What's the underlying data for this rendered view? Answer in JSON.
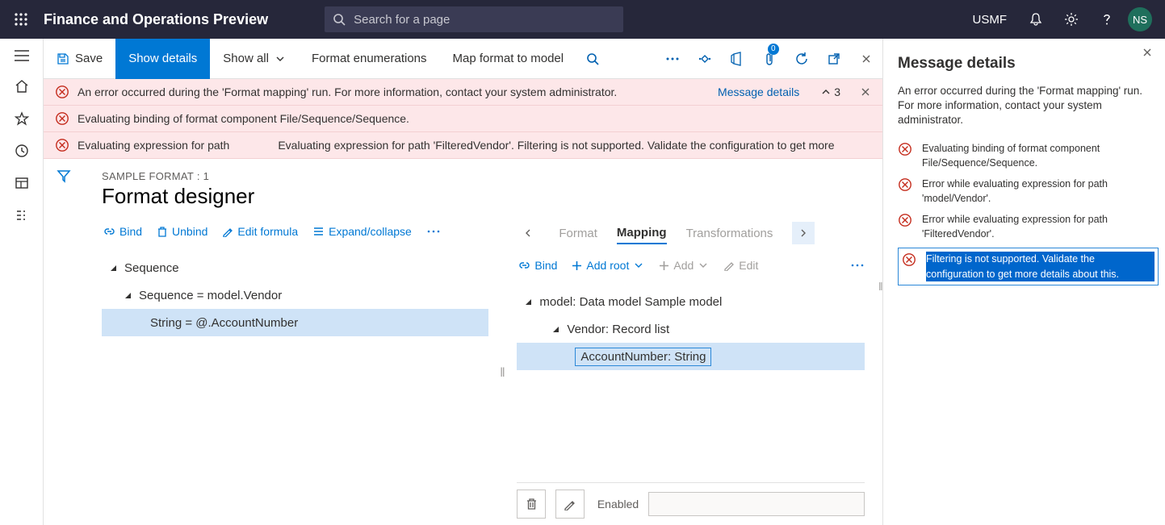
{
  "header": {
    "title": "Finance and Operations Preview",
    "search_placeholder": "Search for a page",
    "company": "USMF",
    "avatar_initials": "NS"
  },
  "actionbar": {
    "save": "Save",
    "show_details": "Show details",
    "show_all": "Show all",
    "format_enum": "Format enumerations",
    "map_format": "Map format to model",
    "attach_badge": "0"
  },
  "errors": {
    "e1": "An error occurred during the 'Format mapping' run. For more information, contact your system administrator.",
    "e1_link": "Message details",
    "e1_count": "3",
    "e2": "Evaluating binding of format component File/Sequence/Sequence.",
    "e3a": "Evaluating expression for path",
    "e3b": "Evaluating expression for path 'FilteredVendor'. Filtering is not supported. Validate the configuration to get more"
  },
  "designer": {
    "breadcrumb": "SAMPLE FORMAT : 1",
    "title": "Format designer",
    "left_toolbar": {
      "bind": "Bind",
      "unbind": "Unbind",
      "edit_formula": "Edit formula",
      "expand": "Expand/collapse"
    },
    "left_tree": {
      "n1": "Sequence",
      "n2": "Sequence = model.Vendor",
      "n3": "String = @.AccountNumber"
    },
    "right_tabs": {
      "format": "Format",
      "mapping": "Mapping",
      "transformations": "Transformations"
    },
    "right_toolbar": {
      "bind": "Bind",
      "add_root": "Add root",
      "add": "Add",
      "edit": "Edit"
    },
    "right_tree": {
      "n1": "model: Data model Sample model",
      "n2": "Vendor: Record list",
      "n3": "AccountNumber: String"
    },
    "bottom": {
      "enabled": "Enabled"
    }
  },
  "sidepanel": {
    "title": "Message details",
    "intro": "An error occurred during the 'Format mapping' run. For more information, contact your system administrator.",
    "m1": "Evaluating binding of format component File/Sequence/Sequence.",
    "m2": "Error while evaluating expression for path 'model/Vendor'.",
    "m3": "Error while evaluating expression for path 'FilteredVendor'.",
    "m4": "Filtering is not supported. Validate the configuration to get more details about this."
  }
}
